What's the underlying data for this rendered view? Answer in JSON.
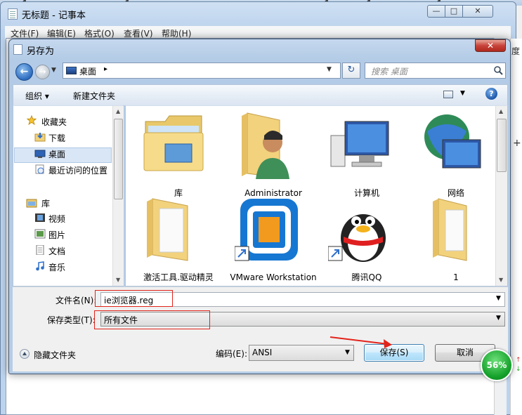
{
  "notepad": {
    "title": "无标题 - 记事本",
    "menu": [
      "文件(F)",
      "编辑(E)",
      "格式(O)",
      "查看(V)",
      "帮助(H)"
    ],
    "window_buttons": {
      "minimize": "—",
      "maximize": "□",
      "close": "✕"
    }
  },
  "right_strip": {
    "du": "度",
    "plus": "+"
  },
  "dialog": {
    "title": "另存为",
    "address": {
      "location": "桌面",
      "separator": "▸"
    },
    "search_placeholder": "搜索 桌面",
    "toolbar": {
      "organize": "组织 ▾",
      "new_folder": "新建文件夹",
      "help": "?"
    },
    "nav": {
      "favorites_header": "收藏夹",
      "favorites": [
        "下载",
        "桌面",
        "最近访问的位置"
      ],
      "libraries_header": "库",
      "libraries": [
        "视频",
        "图片",
        "文档",
        "音乐"
      ]
    },
    "files": [
      {
        "name": "库",
        "icon": "library-folder-icon"
      },
      {
        "name": "Administrator",
        "icon": "user-folder-icon"
      },
      {
        "name": "计算机",
        "icon": "computer-icon"
      },
      {
        "name": "网络",
        "icon": "network-icon"
      },
      {
        "name": "激活工具.驱动精灵",
        "icon": "folder-icon"
      },
      {
        "name": "VMware Workstation",
        "icon": "vmware-shortcut-icon"
      },
      {
        "name": "腾讯QQ",
        "icon": "qq-shortcut-icon"
      },
      {
        "name": "1",
        "icon": "folder-icon"
      }
    ],
    "filename_label": "文件名(N):",
    "filename_value": "ie浏览器.reg",
    "filetype_label": "保存类型(T):",
    "filetype_value": "所有文件",
    "hide_folders": "隐藏文件夹",
    "encoding_label": "编码(E):",
    "encoding_value": "ANSI",
    "save_button": "保存(S)",
    "cancel_button": "取消"
  },
  "badge": {
    "percent": "56%"
  },
  "colors": {
    "annotation_red": "#e2231a",
    "title_gradient": "#b7cde7"
  }
}
